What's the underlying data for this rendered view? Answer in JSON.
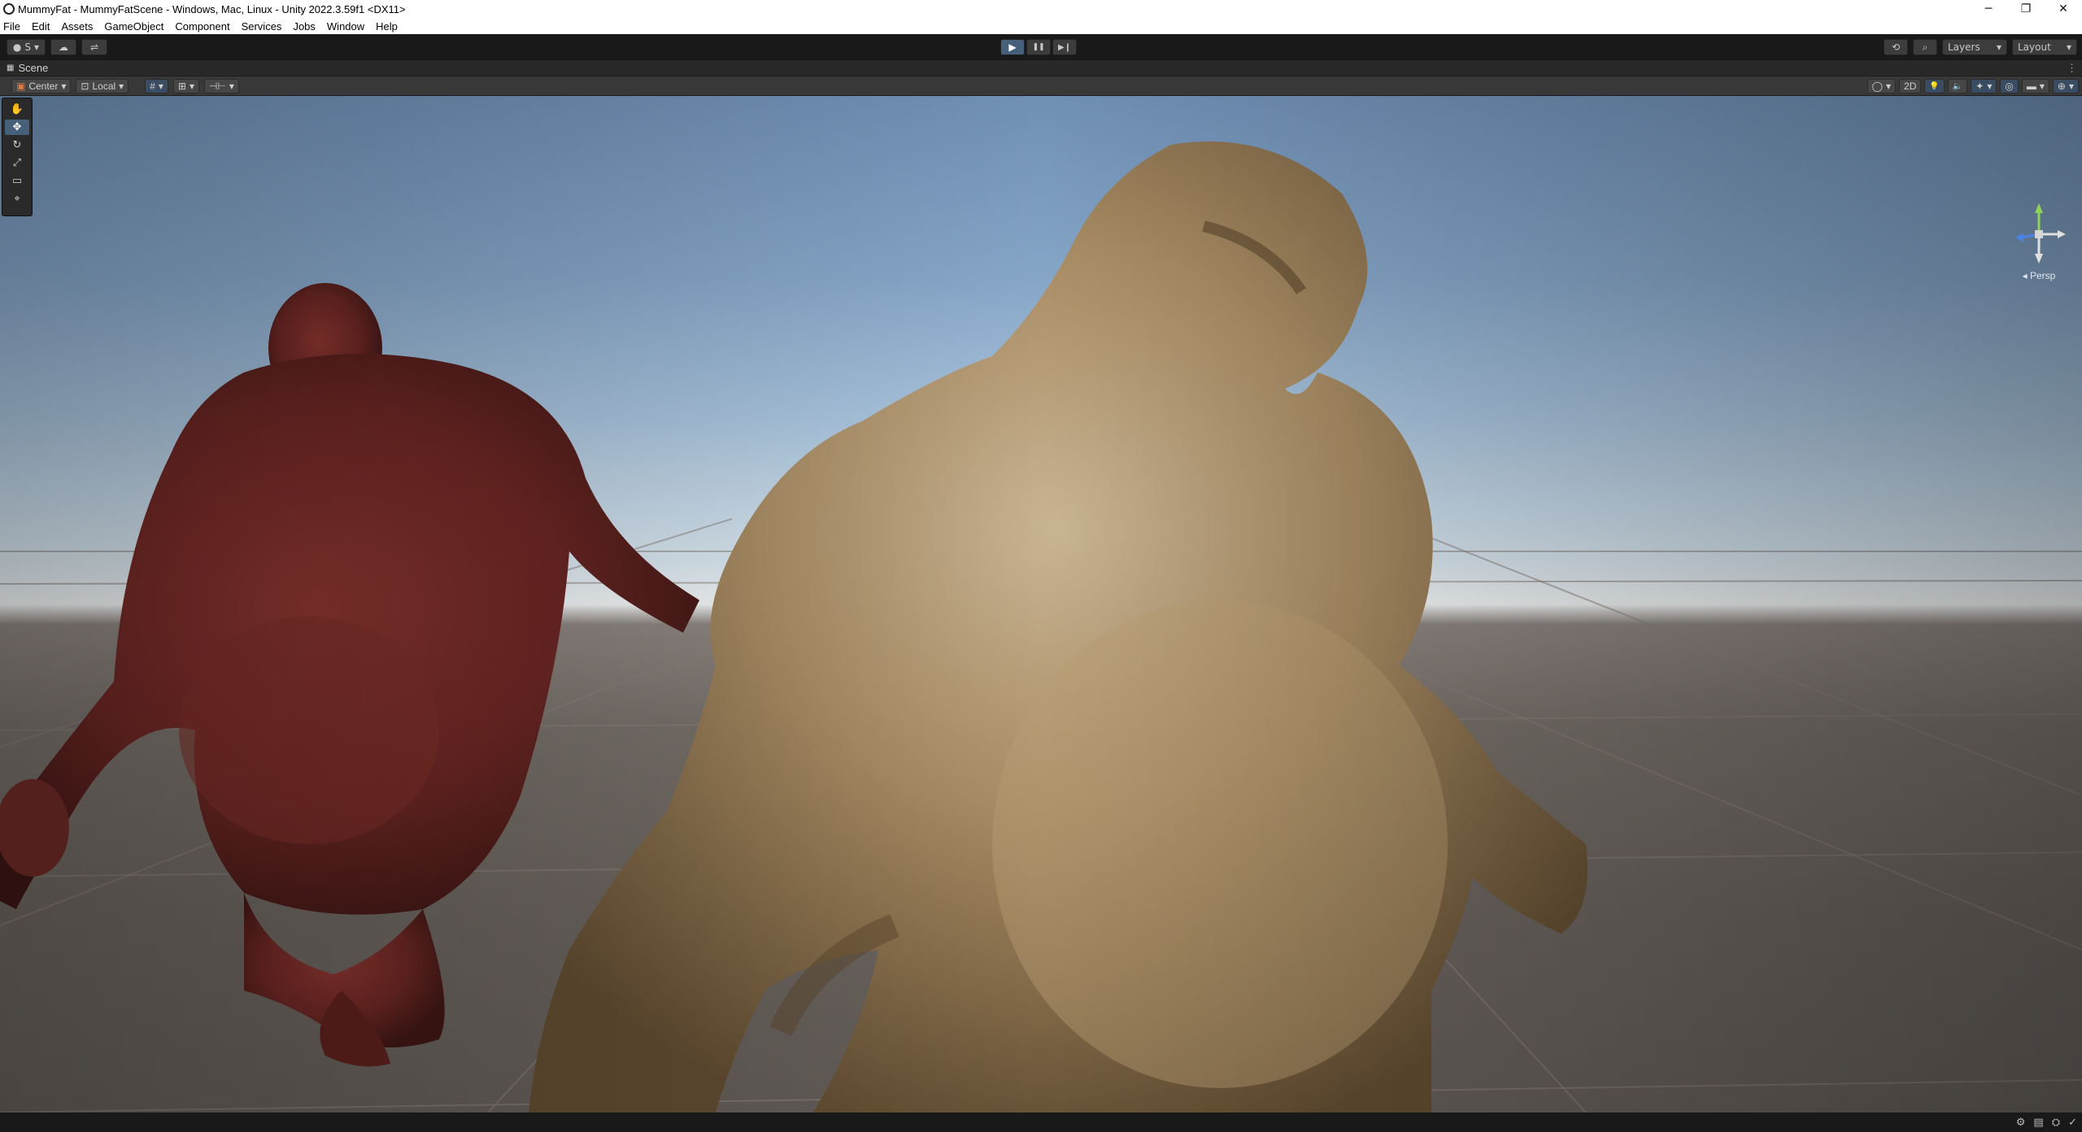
{
  "window": {
    "title": "MummyFat - MummyFatScene - Windows, Mac, Linux - Unity 2022.3.59f1 <DX11>",
    "controls": {
      "minimize": "─",
      "maximize": "❐",
      "close": "✕"
    }
  },
  "menu": [
    "File",
    "Edit",
    "Assets",
    "GameObject",
    "Component",
    "Services",
    "Jobs",
    "Window",
    "Help"
  ],
  "toolbar": {
    "account_label": "S",
    "account_caret": "▾",
    "cloud_icon": "☁",
    "collab_icon": "⇌",
    "play_icon": "▶",
    "pause_icon": "❚❚",
    "step_icon": "▶❙",
    "history_icon": "⟲",
    "search_icon": "⌕",
    "layers_label": "Layers",
    "layout_label": "Layout",
    "caret": "▾"
  },
  "scene_tab": {
    "icon": "▦",
    "label": "Scene",
    "menu": "⋮"
  },
  "scene_tools": {
    "pivot_label": "Center",
    "space_label": "Local",
    "grid_icon": "#",
    "snap_icon": "⊞",
    "increment_icon": "⊣⊢",
    "shading_icon": "◯",
    "mode_2d": "2D",
    "lighting_icon": "💡",
    "audio_icon": "🔈",
    "fx_icon": "✦",
    "hidden_icon": "◎",
    "camera_icon": "▬",
    "gizmos_icon": "⊕",
    "caret": "▾"
  },
  "tools": [
    {
      "name": "hand-tool",
      "icon": "✋"
    },
    {
      "name": "move-tool",
      "icon": "✥"
    },
    {
      "name": "rotate-tool",
      "icon": "↻"
    },
    {
      "name": "scale-tool",
      "icon": "⤢"
    },
    {
      "name": "rect-tool",
      "icon": "▭"
    },
    {
      "name": "transform-tool",
      "icon": "⌖"
    }
  ],
  "gizmo": {
    "projection_label": "◂ Persp",
    "x": "x",
    "y": "y",
    "z": "z"
  },
  "statusbar": [
    "⚙",
    "▤",
    "⛭",
    "✓"
  ],
  "colors": {
    "accent": "#46607c",
    "creature_left": "#7a2c28",
    "creature_right": "#9c8360"
  }
}
